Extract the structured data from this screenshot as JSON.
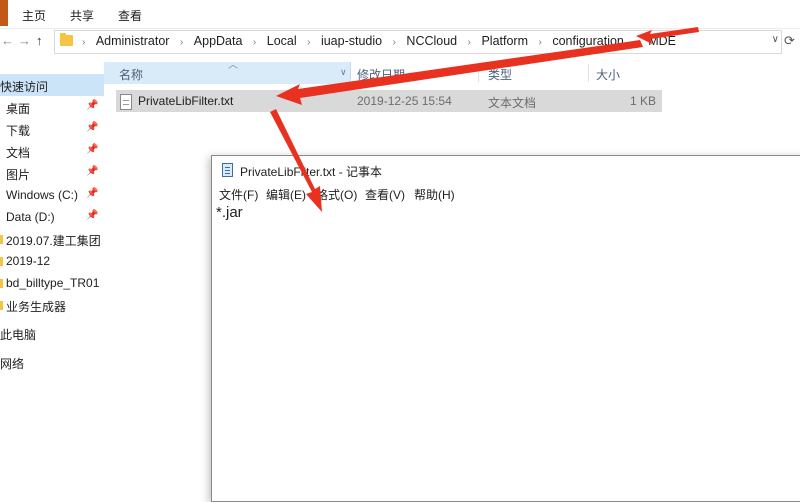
{
  "ribbon": {
    "tabs": [
      "主页",
      "共享",
      "查看"
    ]
  },
  "nav": {
    "back": "←",
    "forward": "→",
    "up": "↑",
    "refresh": "⟳",
    "dropdown": "∨"
  },
  "address": {
    "segments": [
      "Administrator",
      "AppData",
      "Local",
      "iuap-studio",
      "NCCloud",
      "Platform",
      "configuration",
      "MDE"
    ]
  },
  "columns": {
    "name": "名称",
    "modified": "修改日期",
    "type": "类型",
    "size": "大小"
  },
  "file": {
    "name": "PrivateLibFilter.txt",
    "modified": "2019-12-25 15:54",
    "type": "文本文档",
    "size": "1 KB"
  },
  "sidebar": {
    "quick_access": "快速访问",
    "items": [
      {
        "label": "桌面",
        "pinned": true
      },
      {
        "label": "下载",
        "pinned": true
      },
      {
        "label": "文档",
        "pinned": true
      },
      {
        "label": "图片",
        "pinned": true
      },
      {
        "label": "Windows (C:)",
        "pinned": true
      },
      {
        "label": "Data (D:)",
        "pinned": true
      },
      {
        "label": "2019.07.建工集团.",
        "pinned": false
      },
      {
        "label": "2019-12",
        "pinned": false
      },
      {
        "label": "bd_billtype_TR01",
        "pinned": false
      },
      {
        "label": "业务生成器",
        "pinned": false
      }
    ],
    "this_pc": "此电脑",
    "network": "网络"
  },
  "notepad": {
    "title": "PrivateLibFilter.txt - 记事本",
    "menu": [
      "文件(F)",
      "编辑(E)",
      "格式(O)",
      "查看(V)",
      "帮助(H)"
    ],
    "content": "*.jar"
  },
  "colors": {
    "accent_selected": "#cce4f7",
    "arrow_red": "#e8311f",
    "file_tab": "#c15a18"
  }
}
